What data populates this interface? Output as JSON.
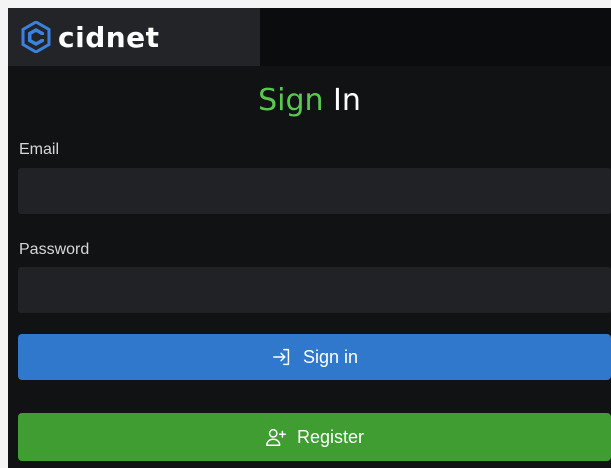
{
  "brand": {
    "name": "cidnet"
  },
  "form": {
    "title_part1": "Sign",
    "title_part2": "In",
    "email_label": "Email",
    "email_value": "",
    "password_label": "Password",
    "password_value": ""
  },
  "buttons": {
    "signin_label": "Sign in",
    "signin_icon": "sign-in-icon",
    "register_label": "Register",
    "register_icon": "user-plus-icon"
  },
  "colors": {
    "accent_green": "#58c94e",
    "signin_blue": "#2f78cc",
    "register_green": "#3f9d32",
    "logo_blue": "#3b82e0"
  }
}
